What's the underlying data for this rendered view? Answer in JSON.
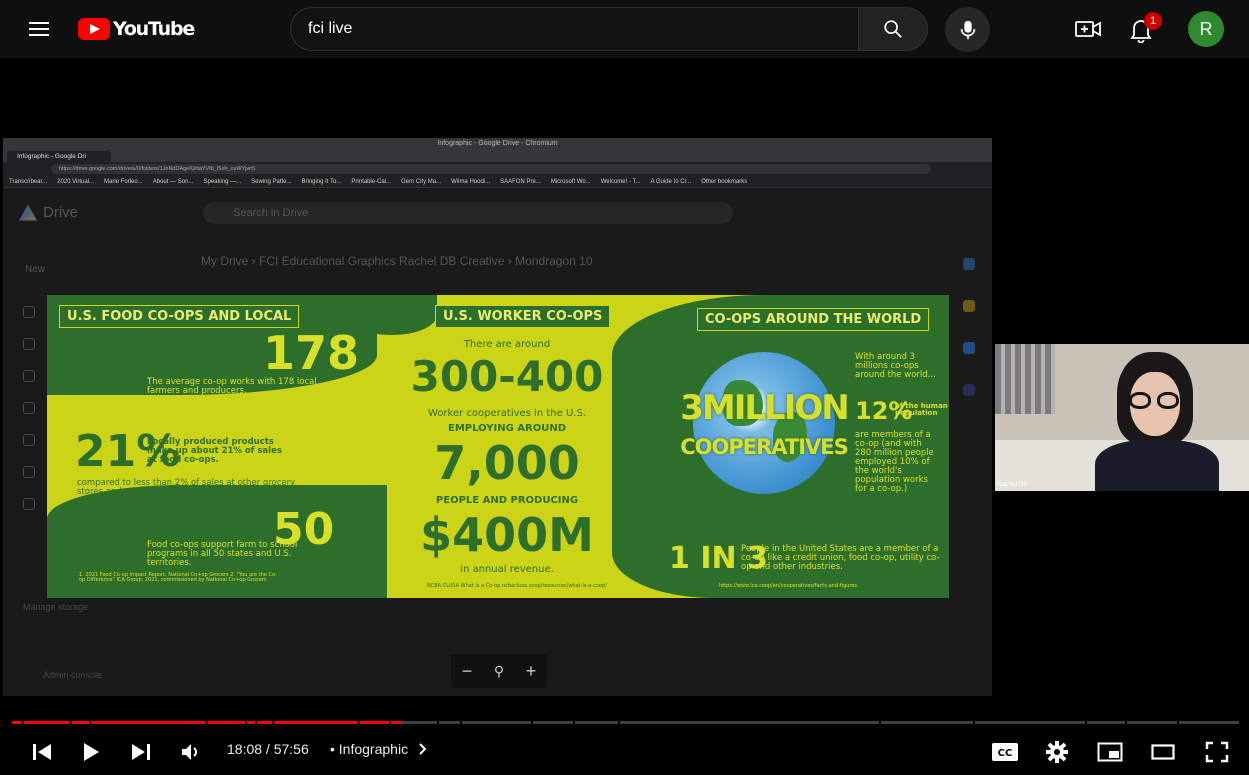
{
  "header": {
    "logo_text": "YouTube",
    "search_value": "fci live",
    "notification_count": "1",
    "avatar_letter": "R"
  },
  "share": {
    "window_title": "Infographic - Google Drive - Chromium",
    "tab_title": "Infographic - Google Dri",
    "url": "https://drive.google.com/drive/u/0/folders/1JnNdDAgeKjIdaYVIb_I5eh_osWYjwr5",
    "bookmarks": [
      "Transcribear...",
      "2020 Virtual...",
      "Marie Forleo...",
      "About — Son...",
      "Speaking —...",
      "Sewing Patte...",
      "Bringing It To...",
      "Printable-Cal...",
      "Gem City Ma...",
      "Wilma Hoodi...",
      "SAAFON Pre...",
      "Microsoft Wo...",
      "Welcome! - T...",
      "A Guide to Cr...",
      "Other bookmarks"
    ],
    "drive_label": "Drive",
    "drive_search": "Search in Drive",
    "breadcrumb": "My Drive  ›  FCI Educational Graphics Rachel DB Creative  ›  Mondragon 10",
    "new_label": "New",
    "manage_storage": "Manage storage",
    "admin": "Admin console"
  },
  "infographic": {
    "food_header": "U.S. FOOD CO-OPS AND LOCAL",
    "n178": "178",
    "n178_text": "The average co-op works with 178 local farmers and producers.",
    "p21": "21%",
    "p21_text": "Locally produced products make up about 21% of sales at food co-ops.",
    "p21_sub": "compared to less than 2% of sales at other grocery stores and supermarkets.",
    "n50": "50",
    "n50_text": "Food co-ops support farm to school programs in all 50 states and U.S. territories.",
    "food_src": "1. 2021 Food Co-op Impact Report, National Co+op Grocers  2. \"You are the Co-op Difference\" ICA Group, 2021, commissioned by National Co+op Grocers",
    "worker_header": "U.S. WORKER CO-OPS",
    "around": "There are around",
    "range": "300-400",
    "worker_text": "Worker cooperatives in the U.S.",
    "employing": "EMPLOYING AROUND",
    "n7000": "7,000",
    "producing": "PEOPLE AND PRODUCING",
    "revenue": "$400M",
    "revenue_text": "in annual revenue.",
    "worker_src": "NCBA CLUSA What is a Co-op ncbaclusa.coop/resources/what-is-a-coop/",
    "world_header": "CO-OPS AROUND THE WORLD",
    "million": "3MILLION",
    "cooperatives": "COOPERATIVES",
    "world_text1": "With around 3 millions co-ops around the world...",
    "p12": "12%",
    "p12_label": "of the human population",
    "world_text2": "are members of a co-op (and with 280 million people employed 10% of the world's population works for a co-op.)",
    "one_in_3": "1 IN 3",
    "one_in_3_text": "People in the United States are a member of a co-op like a credit union, food co-op, utility co-op and other industries.",
    "world_src": "https://www.ica.coop/en/cooperatives/facts-and-figures"
  },
  "webcam": {
    "name": "Rachel DB"
  },
  "player": {
    "time": "18:08 / 57:56",
    "chapter": "Infographic",
    "progress_fraction": 0.313
  },
  "colors": {
    "accent": "#ff0000",
    "coop_green": "#2e6e2b",
    "coop_lime": "#ccd418"
  }
}
